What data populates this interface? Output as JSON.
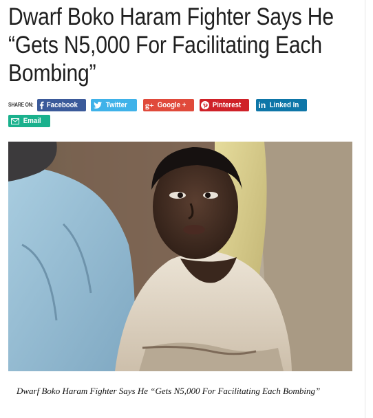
{
  "article": {
    "title": "Dwarf Boko Haram Fighter Says He “Gets N5,000 For Facilitating Each Bombing”",
    "caption": "Dwarf Boko Haram Fighter Says He “Gets N5,000 For Facilitating Each Bombing”"
  },
  "share": {
    "label": "SHARE ON:",
    "buttons": [
      {
        "label": "Facebook",
        "icon": "facebook-icon",
        "color": "#3b5a9a"
      },
      {
        "label": "Twitter",
        "icon": "twitter-icon",
        "color": "#3fb2e9"
      },
      {
        "label": "Google +",
        "icon": "google-plus-icon",
        "color": "#e04a3b"
      },
      {
        "label": "Pinterest",
        "icon": "pinterest-icon",
        "color": "#cf2128"
      },
      {
        "label": "Linked In",
        "icon": "linkedin-icon",
        "color": "#0e76a8"
      },
      {
        "label": "Email",
        "icon": "envelope-icon",
        "color": "#1ab18d"
      }
    ]
  }
}
